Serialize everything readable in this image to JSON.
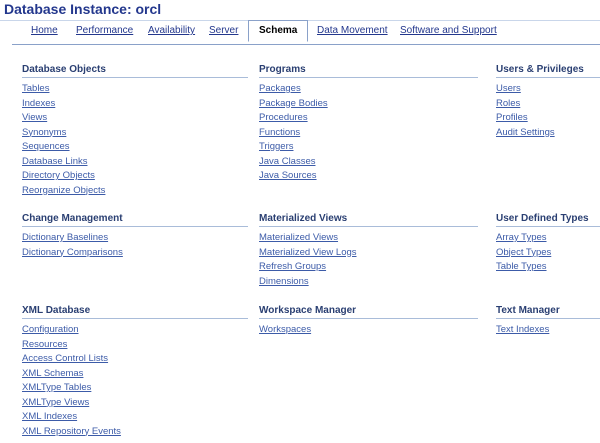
{
  "page": {
    "title": "Database Instance: orcl"
  },
  "tabs": [
    {
      "label": "Home"
    },
    {
      "label": "Performance"
    },
    {
      "label": "Availability"
    },
    {
      "label": "Server"
    },
    {
      "label": "Schema"
    },
    {
      "label": "Data Movement"
    },
    {
      "label": "Software and Support"
    }
  ],
  "active_tab": "Schema",
  "sections": {
    "database_objects": {
      "title": "Database Objects",
      "links": [
        "Tables",
        "Indexes",
        "Views",
        "Synonyms",
        "Sequences",
        "Database Links",
        "Directory Objects",
        "Reorganize Objects"
      ]
    },
    "programs": {
      "title": "Programs",
      "links": [
        "Packages",
        "Package Bodies",
        "Procedures",
        "Functions",
        "Triggers",
        "Java Classes",
        "Java Sources"
      ]
    },
    "users_privileges": {
      "title": "Users & Privileges",
      "links": [
        "Users",
        "Roles",
        "Profiles",
        "Audit Settings"
      ]
    },
    "change_management": {
      "title": "Change Management",
      "links": [
        "Dictionary Baselines",
        "Dictionary Comparisons"
      ]
    },
    "materialized_views": {
      "title": "Materialized Views",
      "links": [
        "Materialized Views",
        "Materialized View Logs",
        "Refresh Groups",
        "Dimensions"
      ]
    },
    "user_defined_types": {
      "title": "User Defined Types",
      "links": [
        "Array Types",
        "Object Types",
        "Table Types"
      ]
    },
    "xml_database": {
      "title": "XML Database",
      "links": [
        "Configuration",
        "Resources",
        "Access Control Lists",
        "XML Schemas",
        "XMLType Tables",
        "XMLType Views",
        "XML Indexes",
        "XML Repository Events"
      ]
    },
    "workspace_manager": {
      "title": "Workspace Manager",
      "links": [
        "Workspaces"
      ]
    },
    "text_manager": {
      "title": "Text Manager",
      "links": [
        "Text Indexes"
      ]
    }
  }
}
